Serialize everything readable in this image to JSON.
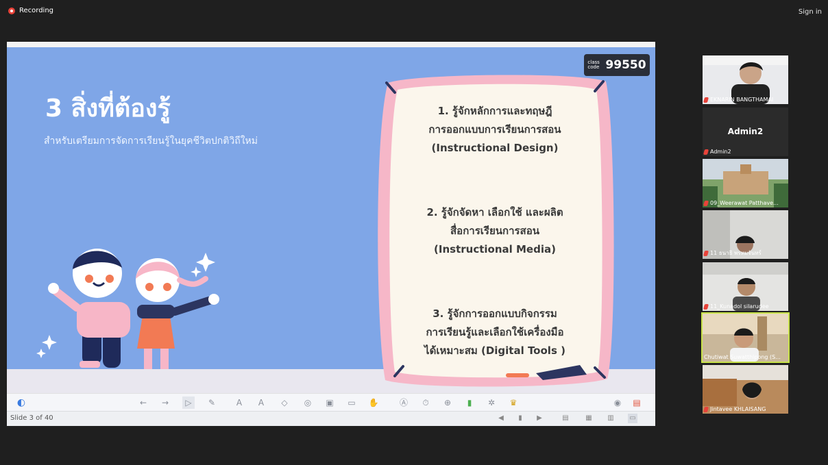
{
  "topbar": {
    "recording_label": "Recording",
    "signin_label": "Sign in"
  },
  "slide": {
    "title": "3 สิ่งที่ต้องรู้",
    "subtitle": "สำหรับเตรียมการจัดการเรียนรู้ในยุคชีวิตปกติวิถีใหม่",
    "class_code_label": "class code",
    "class_code": "99550",
    "items": [
      {
        "lines": [
          "1. รู้จักหลักการและทฤษฎี",
          "การออกแบบการเรียนการสอน",
          "(Instructional Design)"
        ]
      },
      {
        "lines": [
          "2. รู้จักจัดหา เลือกใช้ และผลิต",
          "สื่อการเรียนการสอน",
          "(Instructional Media)"
        ]
      },
      {
        "lines": [
          "3. รู้จักการออกแบบกิจกรรม",
          "การเรียนรู้และเลือกใช้เครื่องมือ",
          "ได้เหมาะสม (Digital Tools )"
        ]
      }
    ]
  },
  "statusbar": {
    "slide_counter": "Slide 3 of 40"
  },
  "participants": [
    {
      "name": "EKNARIN BANGTHAMAI"
    },
    {
      "name": "Admin2",
      "display": "Admin2"
    },
    {
      "name": "09_Weerawat Patthave..."
    },
    {
      "name": "11 ธนาธิ พรหมจันทร์"
    },
    {
      "name": "11_Kunadol silarudee"
    },
    {
      "name": "Chutiwat Suwatthipong (S..."
    },
    {
      "name": "Jintavee KHLAISANG"
    }
  ],
  "colors": {
    "slide_bg": "#7fa6e7",
    "frame_pink": "#f6b7c8",
    "card_bg": "#fbf6ec",
    "active_border": "#c9e34a",
    "rec_red": "#e8433a"
  }
}
